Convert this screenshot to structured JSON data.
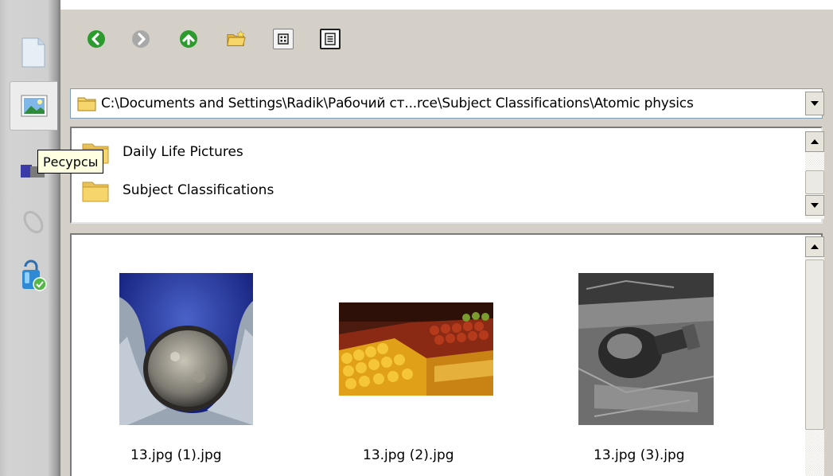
{
  "sidebar": {
    "items": [
      {
        "name": "document-icon"
      },
      {
        "name": "picture-icon",
        "active": true
      },
      {
        "name": "resources-icon"
      },
      {
        "name": "clip-icon"
      },
      {
        "name": "lock-check-icon"
      }
    ],
    "tooltip": "Ресурсы"
  },
  "toolbar": {
    "back": "back-icon",
    "forward": "forward-icon",
    "up": "up-icon",
    "new_folder": "new-folder-icon",
    "thumbnail_view": "thumbnail-view-icon",
    "list_view": "list-view-icon"
  },
  "address": {
    "path": "C:\\Documents and Settings\\Radik\\Рабочий ст...rce\\Subject Classifications\\Atomic physics"
  },
  "folders": [
    {
      "label": "Daily Life Pictures"
    },
    {
      "label": "Subject Classifications"
    }
  ],
  "files": [
    {
      "label": "13.jpg (1).jpg"
    },
    {
      "label": "13.jpg (2).jpg"
    },
    {
      "label": "13.jpg (3).jpg"
    }
  ],
  "colors": {
    "green_button": "#2c9a2c",
    "folder_yellow": "#f4d36a",
    "panel": "#d4d0c8"
  }
}
